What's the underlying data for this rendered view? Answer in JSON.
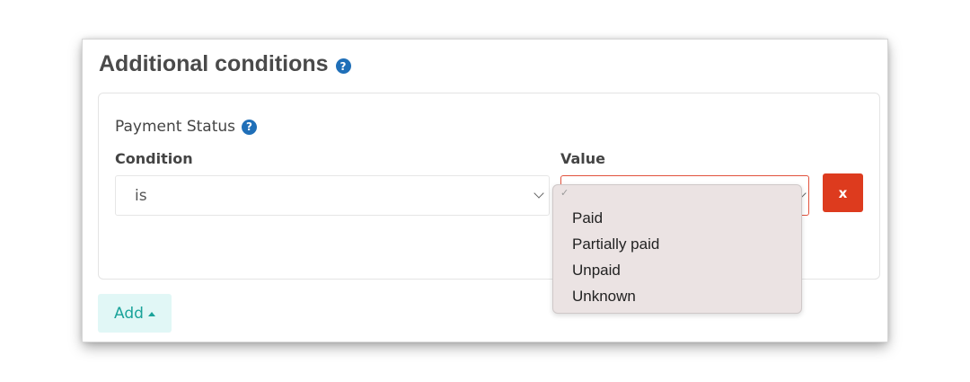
{
  "panel": {
    "title": "Additional conditions",
    "help_icon": "question-circle-icon"
  },
  "field": {
    "title": "Payment Status",
    "help_icon": "question-circle-icon",
    "condition_label": "Condition",
    "value_label": "Value",
    "condition_selected": "is",
    "value_selected": "",
    "remove_label": "x"
  },
  "dropdown": {
    "checkmark": "✓",
    "options": [
      "Paid",
      "Partially paid",
      "Unpaid",
      "Unknown"
    ]
  },
  "add_button": {
    "label": "Add",
    "icon": "caret-up-icon"
  },
  "colors": {
    "accent_blue": "#1f6fb8",
    "danger_red": "#dd3b1e",
    "add_teal": "#1aa39a",
    "add_bg": "#e1f7f6",
    "invalid_border": "#e1523d"
  }
}
